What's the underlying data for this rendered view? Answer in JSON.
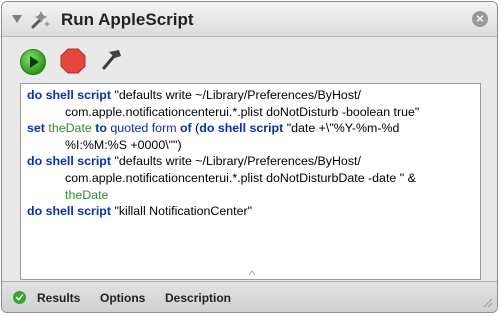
{
  "window": {
    "title": "Run AppleScript",
    "close_symbol": "×"
  },
  "toolbar": {
    "run_icon": "play-icon",
    "stop_icon": "stop-icon",
    "compile_icon": "hammer-icon"
  },
  "script": {
    "line1": {
      "kw": "do shell script",
      "text": " \"defaults write ~/Library/Preferences/ByHost/"
    },
    "line2": {
      "text": "com.apple.notificationcenterui.*.plist doNotDisturb -boolean true\""
    },
    "line3": {
      "set": "set",
      "var": "theDate",
      "to": "to",
      "quoted": "quoted form",
      "of": "of",
      "open": " (",
      "kw": "do shell script",
      "text": " \"date +\\\"%Y-%m-%d"
    },
    "line4": {
      "text": "%I:%M:%S +0000\\\"\")"
    },
    "line5": {
      "kw": "do shell script",
      "text": " \"defaults write ~/Library/Preferences/ByHost/"
    },
    "line6": {
      "text": "com.apple.notificationcenterui.*.plist doNotDisturbDate -date \" &"
    },
    "line7": {
      "var": "theDate"
    },
    "line8": {
      "kw": "do shell script",
      "text": " \"killall NotificationCenter\""
    }
  },
  "footer": {
    "status_icon": "checkmark-icon",
    "tabs": [
      "Results",
      "Options",
      "Description"
    ]
  }
}
